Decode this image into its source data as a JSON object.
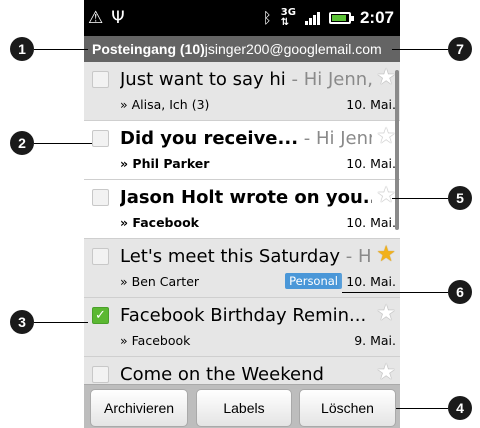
{
  "status_bar": {
    "icons": [
      "warning-icon",
      "usb-icon",
      "bluetooth-icon",
      "3g-icon",
      "signal-icon",
      "battery-icon"
    ],
    "time": "2:07"
  },
  "account_header": {
    "folder": "Posteingang (10)",
    "email": "jsinger200@googlemail.com"
  },
  "messages": [
    {
      "subject": "Just want to say hi",
      "snippet": " - Hi Jenn,...",
      "from": "» Alisa, Ich (3)",
      "date": "10. Mai.",
      "unread": false,
      "starred": false,
      "checked": false
    },
    {
      "subject": "Did you receive...",
      "snippet": " - Hi Jenn...",
      "from": "» Phil Parker",
      "date": "10. Mai.",
      "unread": true,
      "starred": false,
      "checked": false
    },
    {
      "subject": "Jason Holt wrote on you...",
      "snippet": "",
      "from": "» Facebook",
      "date": "10. Mai.",
      "unread": true,
      "starred": false,
      "checked": false
    },
    {
      "subject": "Let's meet this Saturday",
      "snippet": " - Hi ...",
      "from": "» Ben Carter",
      "date": "10. Mai.",
      "unread": false,
      "starred": true,
      "checked": false,
      "label": "Personal"
    },
    {
      "subject": "Facebook Birthday Remin...",
      "snippet": "",
      "from": "» Facebook",
      "date": "9. Mai.",
      "unread": false,
      "starred": false,
      "checked": true
    },
    {
      "subject": "Come on the Weekend",
      "snippet": "",
      "from": "",
      "date": "",
      "unread": false,
      "starred": false,
      "checked": false
    }
  ],
  "actions": {
    "archive": "Archivieren",
    "labels": "Labels",
    "delete": "Löschen"
  },
  "callouts": [
    "1",
    "2",
    "3",
    "4",
    "5",
    "6",
    "7"
  ],
  "colors": {
    "status_bar": "#000000",
    "account_header": "#646464",
    "read_row": "#e6e6e6",
    "unread_row": "#ffffff",
    "checkbox_checked": "#5bb832",
    "star_on": "#f2b11a",
    "label_personal": "#4a97d8"
  }
}
